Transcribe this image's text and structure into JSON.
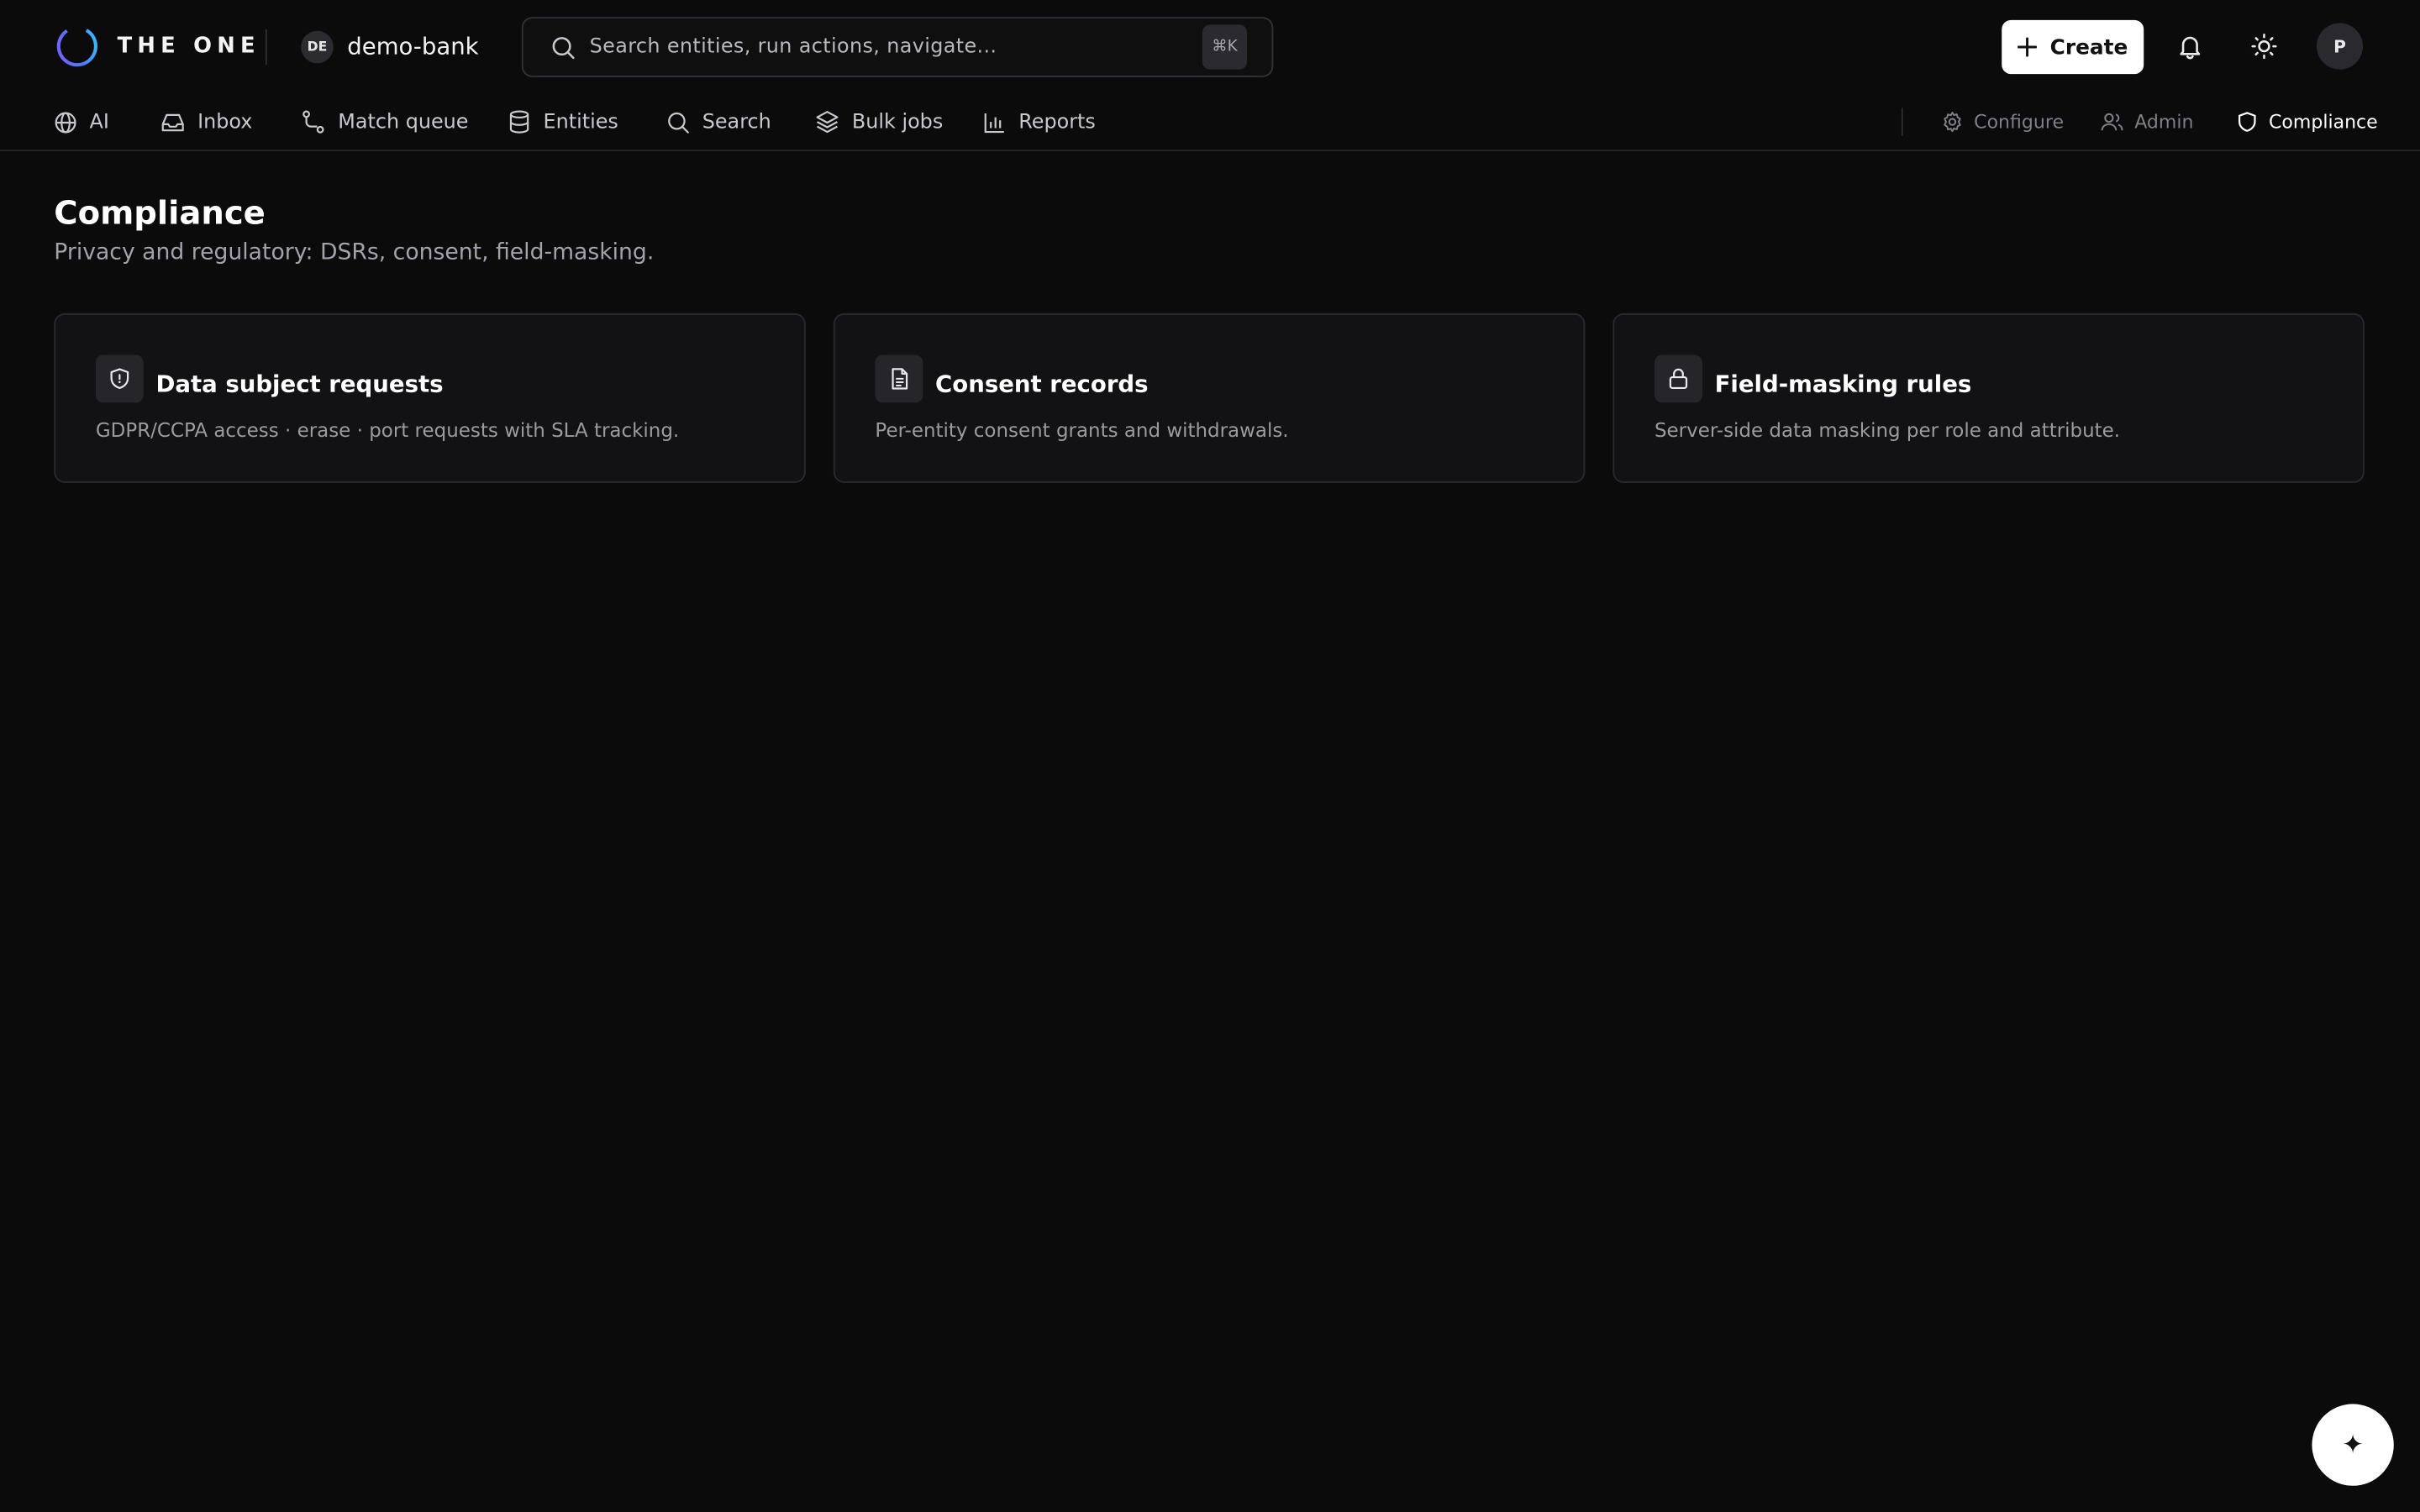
{
  "brand": {
    "name": "THE ONE"
  },
  "workspace": {
    "initials": "DE",
    "name": "demo-bank"
  },
  "search": {
    "placeholder": "Search entities, run actions, navigate...",
    "shortcut": "⌘K"
  },
  "header": {
    "create_label": "Create",
    "avatar_initial": "P"
  },
  "nav": {
    "main": [
      {
        "label": "AI",
        "icon": "globe-icon"
      },
      {
        "label": "Inbox",
        "icon": "inbox-icon"
      },
      {
        "label": "Match queue",
        "icon": "route-icon"
      },
      {
        "label": "Entities",
        "icon": "database-icon"
      },
      {
        "label": "Search",
        "icon": "search-icon"
      },
      {
        "label": "Bulk jobs",
        "icon": "layers-icon"
      },
      {
        "label": "Reports",
        "icon": "bar-chart-icon"
      }
    ],
    "secondary": [
      {
        "label": "Configure",
        "icon": "gear-icon"
      },
      {
        "label": "Admin",
        "icon": "users-icon"
      },
      {
        "label": "Compliance",
        "icon": "shield-icon",
        "active": true
      }
    ]
  },
  "page": {
    "title": "Compliance",
    "subtitle": "Privacy and regulatory: DSRs, consent, field-masking."
  },
  "cards": [
    {
      "title": "Data subject requests",
      "description": "GDPR/CCPA access · erase · port requests with SLA tracking.",
      "icon": "shield-icon"
    },
    {
      "title": "Consent records",
      "description": "Per-entity consent grants and withdrawals.",
      "icon": "document-icon"
    },
    {
      "title": "Field-masking rules",
      "description": "Server-side data masking per role and attribute.",
      "icon": "lock-icon"
    }
  ],
  "fab": {
    "symbol": "✦",
    "icon": "sparkle-icon"
  },
  "colors": {
    "background": "#0b0b0c",
    "card": "#121214",
    "border": "#2a2a2e",
    "primary_button": "#ffffff"
  }
}
